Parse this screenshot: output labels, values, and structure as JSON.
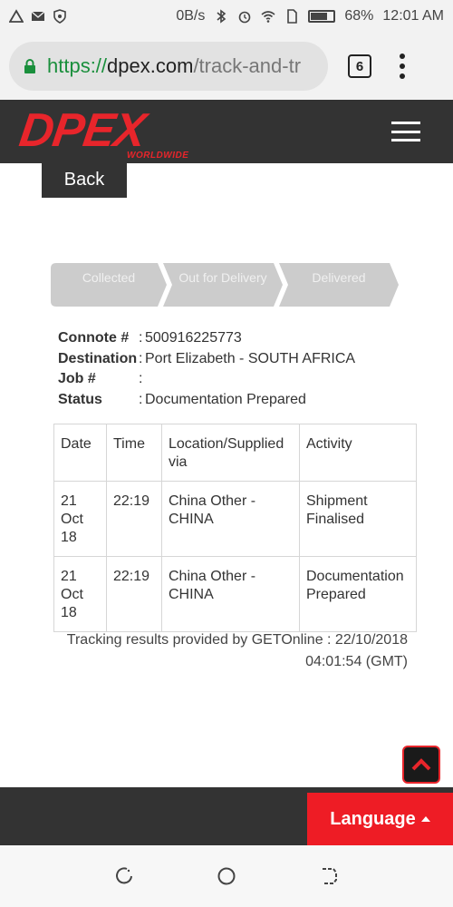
{
  "status_bar": {
    "speed": "0B/s",
    "battery": "68%",
    "time": "12:01 AM"
  },
  "browser": {
    "url_scheme": "https://",
    "url_host": "dpex.com",
    "url_path": "/track-and-tr",
    "tab_count": "6"
  },
  "header": {
    "logo_text": "DPEX",
    "logo_sub": "WORLDWIDE",
    "back_label": "Back"
  },
  "steps": [
    "Collected",
    "Out for Delivery",
    "Delivered"
  ],
  "details": {
    "connote_label": "Connote #",
    "connote_value": "500916225773",
    "destination_label": "Destination",
    "destination_value": "Port Elizabeth - SOUTH AFRICA",
    "job_label": "Job #",
    "job_value": "",
    "status_label": "Status",
    "status_value": "Documentation Prepared",
    "separator": ":"
  },
  "table": {
    "headers": [
      "Date",
      "Time",
      "Location/Supplied via",
      "Activity"
    ],
    "rows": [
      [
        "21 Oct 18",
        "22:19",
        "China Other - CHINA",
        "Shipment Finalised"
      ],
      [
        "21 Oct 18",
        "22:19",
        "China Other - CHINA",
        "Documentation Prepared"
      ]
    ]
  },
  "provided_text": "Tracking results provided by GETOnline : 22/10/2018 04:01:54 (GMT)",
  "footer": {
    "language_label": "Language"
  },
  "colors": {
    "brand_red": "#e8252b",
    "dark": "#333333",
    "step_gray": "#cccccc"
  }
}
